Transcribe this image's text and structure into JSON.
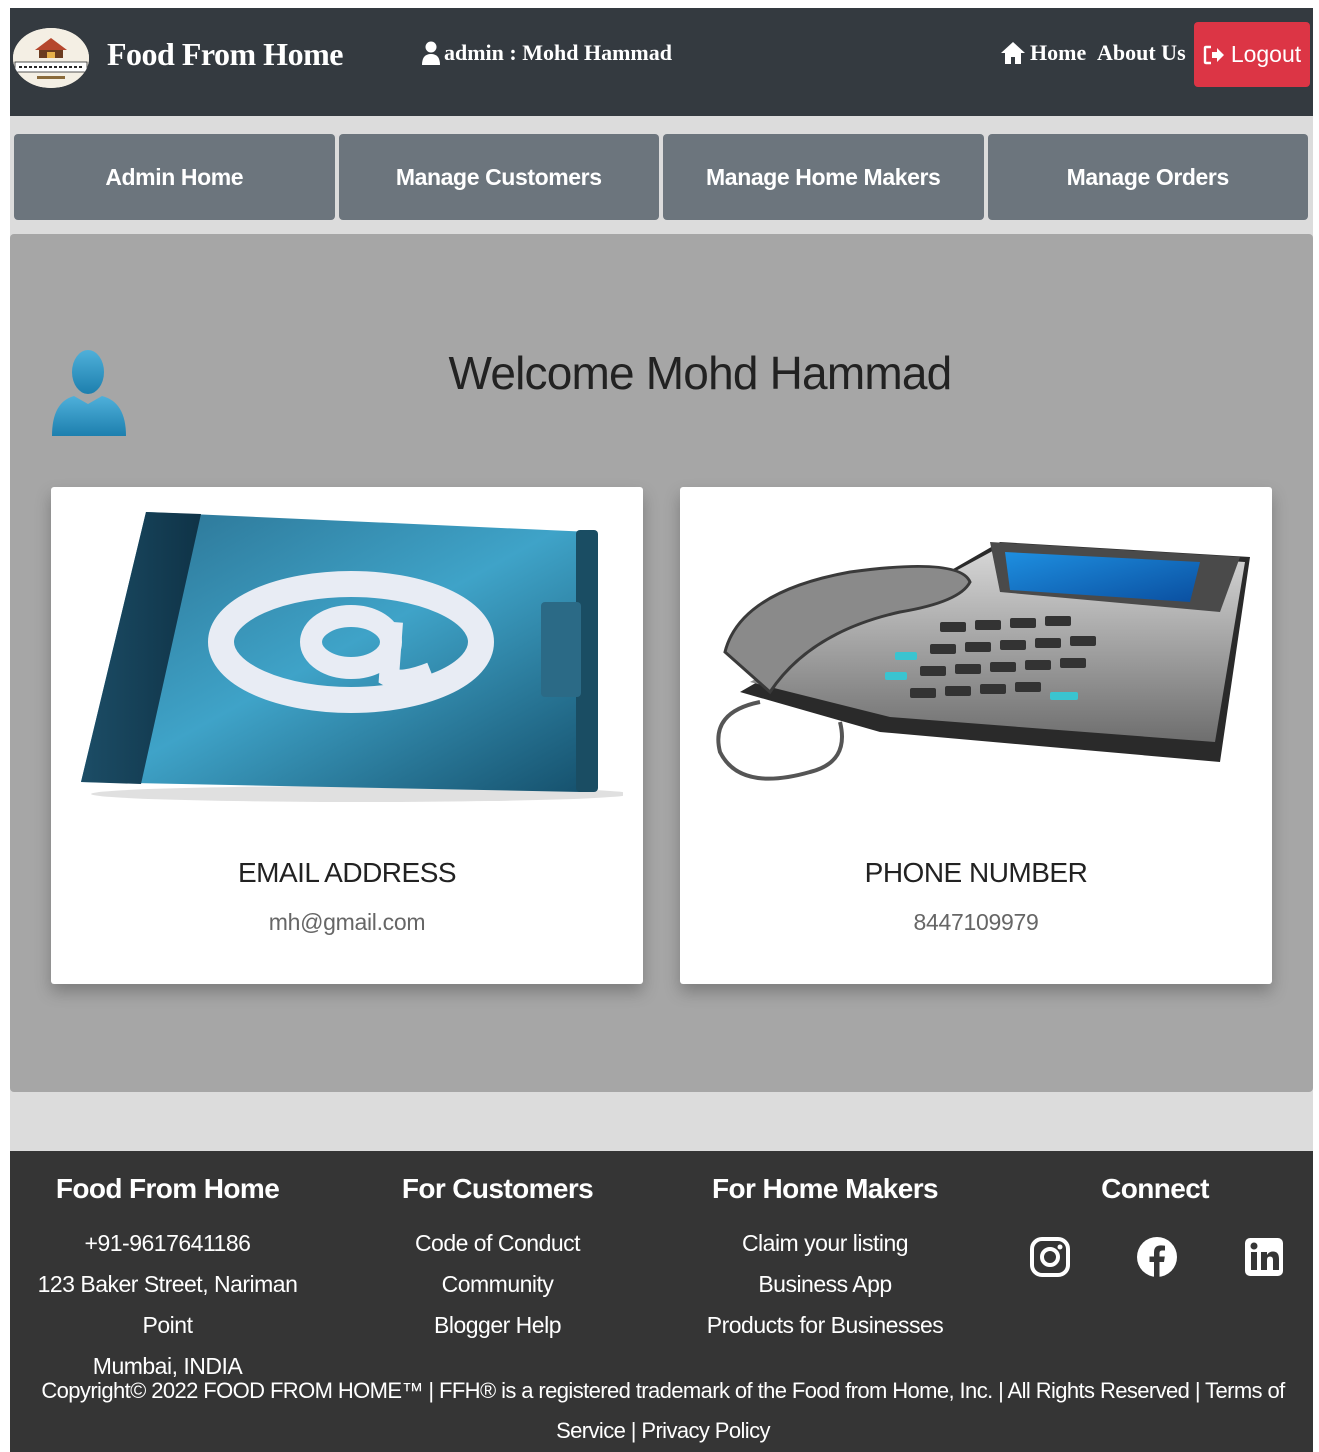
{
  "navbar": {
    "brand": "Food From Home",
    "admin_label": "admin : Mohd Hammad",
    "home_label": "Home",
    "about_label": "About Us",
    "logout_label": "Logout"
  },
  "tabs": [
    {
      "label": "Admin Home"
    },
    {
      "label": "Manage Customers"
    },
    {
      "label": "Manage Home Makers"
    },
    {
      "label": "Manage Orders"
    }
  ],
  "main": {
    "welcome": "Welcome Mohd Hammad",
    "email_card": {
      "title": "EMAIL ADDRESS",
      "value": "mh@gmail.com"
    },
    "phone_card": {
      "title": "PHONE NUMBER",
      "value": "8447109979"
    }
  },
  "footer": {
    "col1": {
      "title": "Food From Home",
      "lines": [
        "+91-9617641186",
        "123 Baker Street, Nariman Point",
        "Mumbai, INDIA"
      ]
    },
    "col2": {
      "title": "For Customers",
      "links": [
        "Code of Conduct",
        "Community",
        "Blogger Help"
      ]
    },
    "col3": {
      "title": "For Home Makers",
      "links": [
        "Claim your listing",
        "Business App",
        "Products for Businesses"
      ]
    },
    "col4": {
      "title": "Connect",
      "icons": [
        "instagram-icon",
        "facebook-icon",
        "linkedin-icon"
      ]
    },
    "copyright": "Copyright© 2022 FOOD FROM HOME™ | FFH® is a registered trademark of the Food from Home, Inc. | All Rights Reserved | Terms of Service | Privacy Policy"
  },
  "colors": {
    "navbar": "#343a40",
    "tab": "#6c757d",
    "logout": "#dc3545",
    "main_bg": "#a6a6a6",
    "footer": "#353535"
  }
}
